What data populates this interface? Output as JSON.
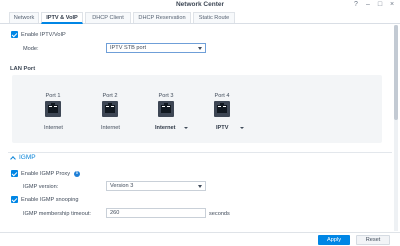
{
  "window": {
    "title": "Network Center",
    "controls": [
      "help-icon",
      "minimize-icon",
      "maximize-icon",
      "close-icon"
    ]
  },
  "tabs": [
    {
      "label": "Network",
      "active": false
    },
    {
      "label": "IPTV & VoIP",
      "active": true
    },
    {
      "label": "DHCP Client",
      "active": false
    },
    {
      "label": "DHCP Reservation",
      "active": false
    },
    {
      "label": "Static Route",
      "active": false
    }
  ],
  "iptv": {
    "enable_label": "Enable IPTV/VoIP",
    "enable_checked": true,
    "mode_label": "Mode:",
    "mode_value": "IPTV STB port"
  },
  "lan": {
    "title": "LAN Port",
    "ports": [
      {
        "name": "Port 1",
        "value": "Internet",
        "dropdown": false,
        "bold": false
      },
      {
        "name": "Port 2",
        "value": "Internet",
        "dropdown": false,
        "bold": false
      },
      {
        "name": "Port 3",
        "value": "Internet",
        "dropdown": true,
        "bold": true
      },
      {
        "name": "Port 4",
        "value": "IPTV",
        "dropdown": true,
        "bold": true
      }
    ]
  },
  "igmp": {
    "title": "IGMP",
    "proxy_label": "Enable IGMP Proxy",
    "proxy_checked": true,
    "version_label": "IGMP version:",
    "version_value": "Version 3",
    "snooping_label": "Enable IGMP snooping",
    "snooping_checked": true,
    "timeout_label": "IGMP membership timeout:",
    "timeout_value": "260",
    "timeout_unit": "seconds"
  },
  "footer": {
    "apply_label": "Apply",
    "reset_label": "Reset"
  },
  "colors": {
    "accent": "#0086e5",
    "lan_panel_bg": "#f3f5f7"
  }
}
